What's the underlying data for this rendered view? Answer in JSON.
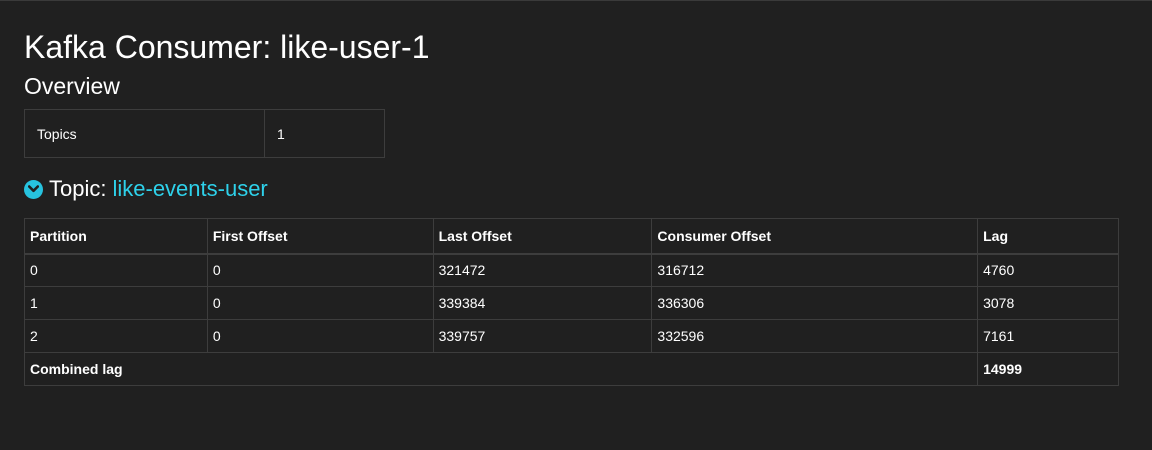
{
  "page": {
    "title": "Kafka Consumer: like-user-1",
    "overview_heading": "Overview"
  },
  "overview": {
    "rows": [
      {
        "label": "Topics",
        "value": "1"
      }
    ]
  },
  "topic": {
    "prefix": "Topic:",
    "name": "like-events-user",
    "toggle_icon": "chevron-down-circle-icon",
    "accent_color": "#2ed1ea"
  },
  "partitions": {
    "headers": [
      "Partition",
      "First Offset",
      "Last Offset",
      "Consumer Offset",
      "Lag"
    ],
    "rows": [
      [
        "0",
        "0",
        "321472",
        "316712",
        "4760"
      ],
      [
        "1",
        "0",
        "339384",
        "336306",
        "3078"
      ],
      [
        "2",
        "0",
        "339757",
        "332596",
        "7161"
      ]
    ],
    "total_label": "Combined lag",
    "total_value": "14999"
  }
}
